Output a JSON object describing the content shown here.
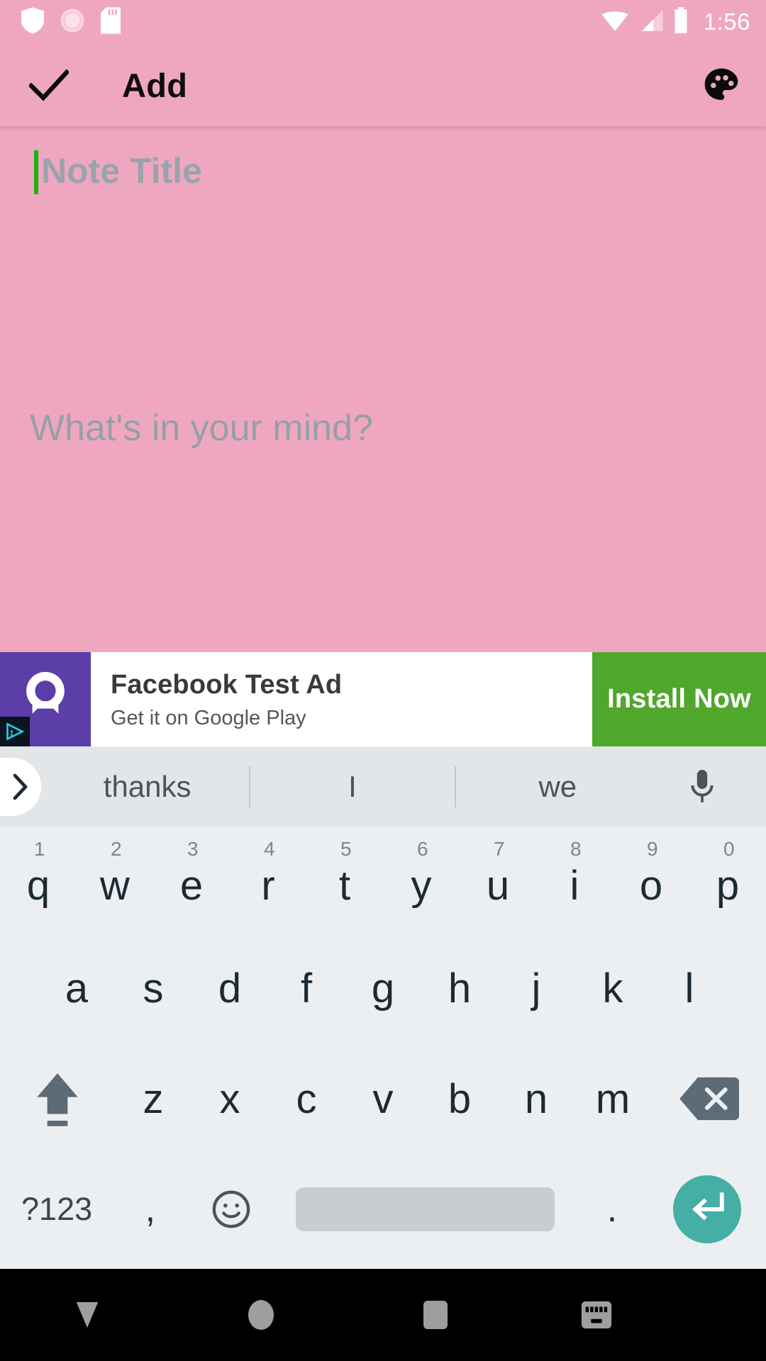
{
  "status_bar": {
    "time": "1:56",
    "left_icons": [
      "shield-icon",
      "sync-circle-icon",
      "sd-card-icon"
    ],
    "right_icons": [
      "wifi-icon",
      "cell-signal-icon",
      "battery-icon"
    ],
    "icon_color": "#FFFFFF"
  },
  "app_bar": {
    "title": "Add",
    "confirm_icon": "check-icon",
    "theme_icon": "palette-icon",
    "background": "#EFA7BF",
    "text_color": "#0D0D0D"
  },
  "note": {
    "title_placeholder": "Note Title",
    "title_value": "",
    "content_placeholder": "What's in your mind?",
    "content_value": "",
    "placeholder_color": "#9AA3AD",
    "caret_color": "#16B510",
    "background": "#EFA7BF"
  },
  "ad": {
    "title": "Facebook Test Ad",
    "subtitle": "Get it on Google Play",
    "cta_label": "Install Now",
    "cta_color": "#4FA72B",
    "icon_background": "#5C3EA8",
    "icon_name": "rocket-avatar-icon",
    "adchoices_icon": "adchoices-icon"
  },
  "keyboard": {
    "suggestions": [
      "thanks",
      "I",
      "we"
    ],
    "expand_icon": "chevron-right-icon",
    "mic_icon": "microphone-icon",
    "row1": [
      {
        "letter": "q",
        "num": "1"
      },
      {
        "letter": "w",
        "num": "2"
      },
      {
        "letter": "e",
        "num": "3"
      },
      {
        "letter": "r",
        "num": "4"
      },
      {
        "letter": "t",
        "num": "5"
      },
      {
        "letter": "y",
        "num": "6"
      },
      {
        "letter": "u",
        "num": "7"
      },
      {
        "letter": "i",
        "num": "8"
      },
      {
        "letter": "o",
        "num": "9"
      },
      {
        "letter": "p",
        "num": "0"
      }
    ],
    "row2": [
      "a",
      "s",
      "d",
      "f",
      "g",
      "h",
      "j",
      "k",
      "l"
    ],
    "row3": [
      "z",
      "x",
      "c",
      "v",
      "b",
      "n",
      "m"
    ],
    "shift_icon": "shift-arrow-icon",
    "backspace_icon": "backspace-icon",
    "symbols_label": "?123",
    "comma_label": ",",
    "emoji_icon": "emoji-smiley-icon",
    "period_label": ".",
    "enter_icon": "enter-arrow-icon",
    "enter_color": "#45AFA6",
    "background": "#ECEFF1",
    "suggestion_background": "#E3E6E8",
    "key_text_color": "#1B2A33"
  },
  "nav_bar": {
    "back_icon": "dismiss-keyboard-triangle-icon",
    "home_icon": "home-circle-icon",
    "recents_icon": "recents-square-icon",
    "switcher_icon": "keyboard-switcher-icon",
    "background": "#000000",
    "icon_color": "#9E9E9E"
  }
}
